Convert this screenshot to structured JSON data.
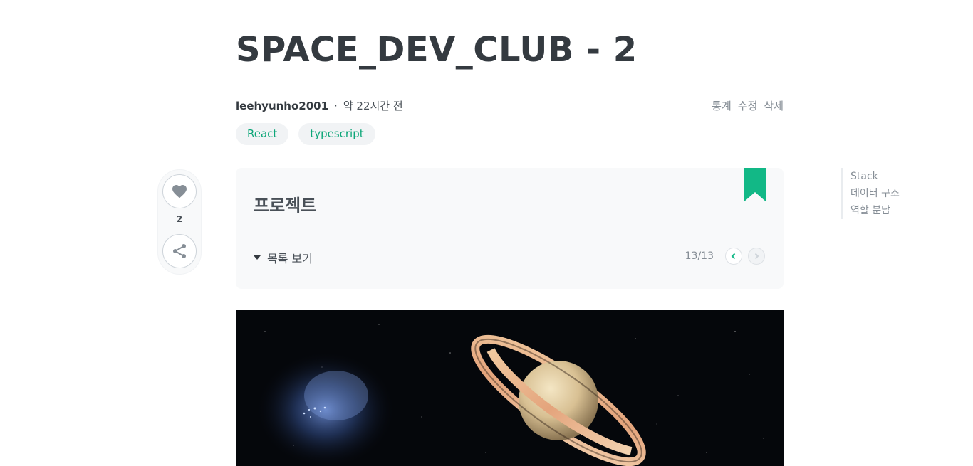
{
  "post": {
    "title": "SPACE_DEV_CLUB - 2",
    "author": "leehyunho2001",
    "separator": "·",
    "time": "약 22시간 전",
    "actions": [
      "통계",
      "수정",
      "삭제"
    ],
    "tags": [
      "React",
      "typescript"
    ]
  },
  "side": {
    "like_count": "2",
    "like_icon": "heart-icon",
    "share_icon": "share-icon"
  },
  "series": {
    "title": "프로젝트",
    "toggle_label": "목록 보기",
    "position": "13/13",
    "bookmark_color": "#12b886"
  },
  "toc": {
    "items": [
      "Stack",
      "데이터 구조",
      "역할 분담"
    ]
  },
  "colors": {
    "accent": "#12b886",
    "tag_text": "#0ca678"
  }
}
